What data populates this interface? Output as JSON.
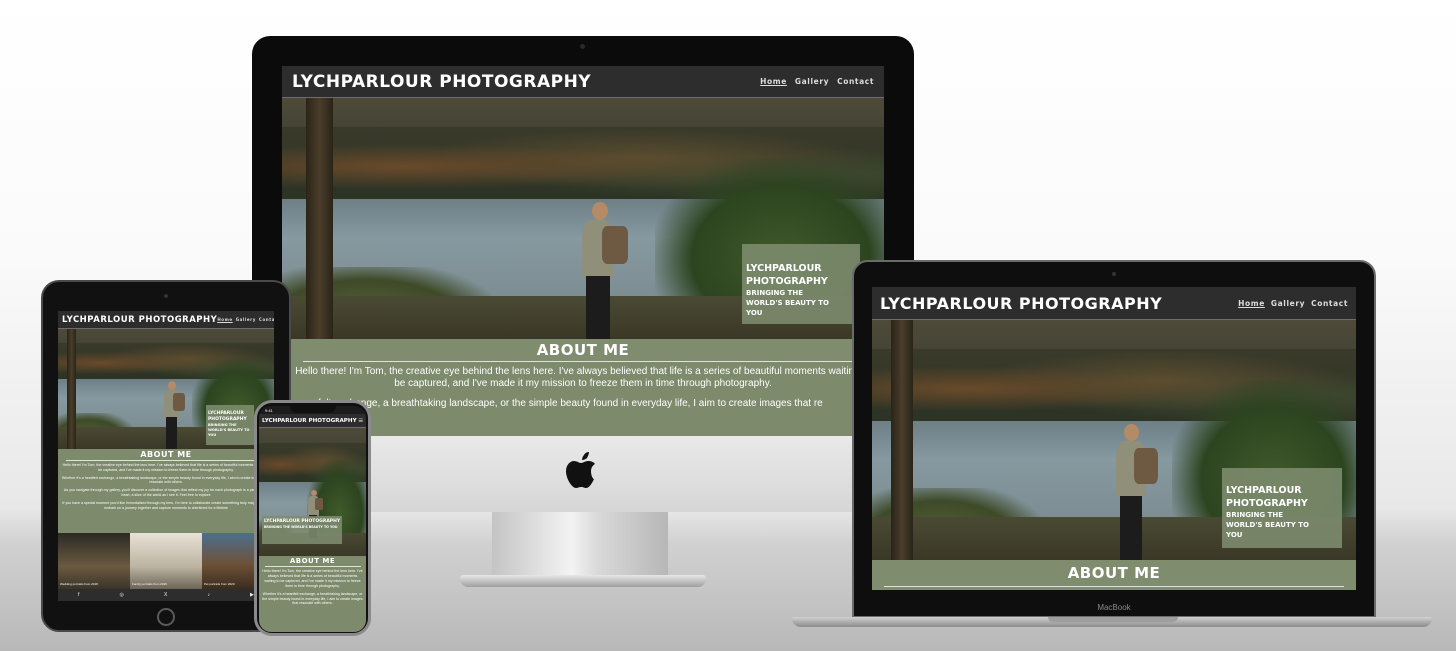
{
  "site": {
    "brand": "LYCHPARLOUR PHOTOGRAPHY",
    "nav": [
      "Home",
      "Gallery",
      "Contact"
    ],
    "hero_caption_line1": "LYCHPARLOUR",
    "hero_caption_line2": "PHOTOGRAPHY",
    "hero_caption_tagline": "BRINGING THE WORLD'S BEAUTY TO YOU",
    "about_title": "ABOUT ME",
    "about_p1": "Hello there! I'm Tom, the creative eye behind the lens here. I've always believed that life is a series of beautiful moments waiting to be captured, and I've made it my mission to freeze them in time through photography.",
    "about_p2_partial": "felt exchange, a breathtaking landscape, or the simple beauty found in everyday life, I aim to create images that re",
    "ipad_about_p1": "Hello there! I'm Tom, the creative eye behind the lens here. I've always believed that life is a series of beautiful moments waiting to be captured, and I've made it my mission to freeze them in time through photography.",
    "ipad_about_p2": "Whether it's a heartfelt exchange, a breathtaking landscape, or the simple beauty found in everyday life, I aim to create images that resonate with others.",
    "ipad_about_p3": "As you navigate through my gallery, you'll discover a collection of images that reflect my joy for each photograph is a piece of my heart, a slice of the world as I see it. Feel free to explore",
    "ipad_about_p4": "If you have a special moment you'd like immortalized through my lens, I'm here to collaborate create something truly magical. Let's embark on a journey together and capture moments to cherished for a lifetime",
    "ipad_gallery_caption_1": "Wedding portraits from 2018",
    "ipad_gallery_caption_2": "Family portraits from 2019",
    "ipad_gallery_caption_3": "Pet portraits from 2020",
    "footer_icons": [
      "facebook-icon",
      "instagram-icon",
      "x-icon",
      "tiktok-icon",
      "youtube-icon"
    ],
    "footer_glyphs": [
      "f",
      "◎",
      "X",
      "♪",
      "▶"
    ],
    "phone_about_p1": "Hello there! I'm Tom, the creative eye behind the lens here. I've always believed that life is a series of beautiful moments waiting to be captured, and I've made it my mission to freeze them in time through photography.",
    "phone_about_p2": "Whether it's a heartfelt exchange, a breathtaking landscape, or the simple beauty found in everyday life, I aim to create images that resonate with others.",
    "phone_time": "9:41",
    "phone_menu_icon": "≡"
  },
  "devices": {
    "laptop_label": "MacBook"
  },
  "colors": {
    "header_bg": "#2d2d2d",
    "accent_green": "#7f8c6e",
    "caption_box": "#7d8c6e"
  }
}
